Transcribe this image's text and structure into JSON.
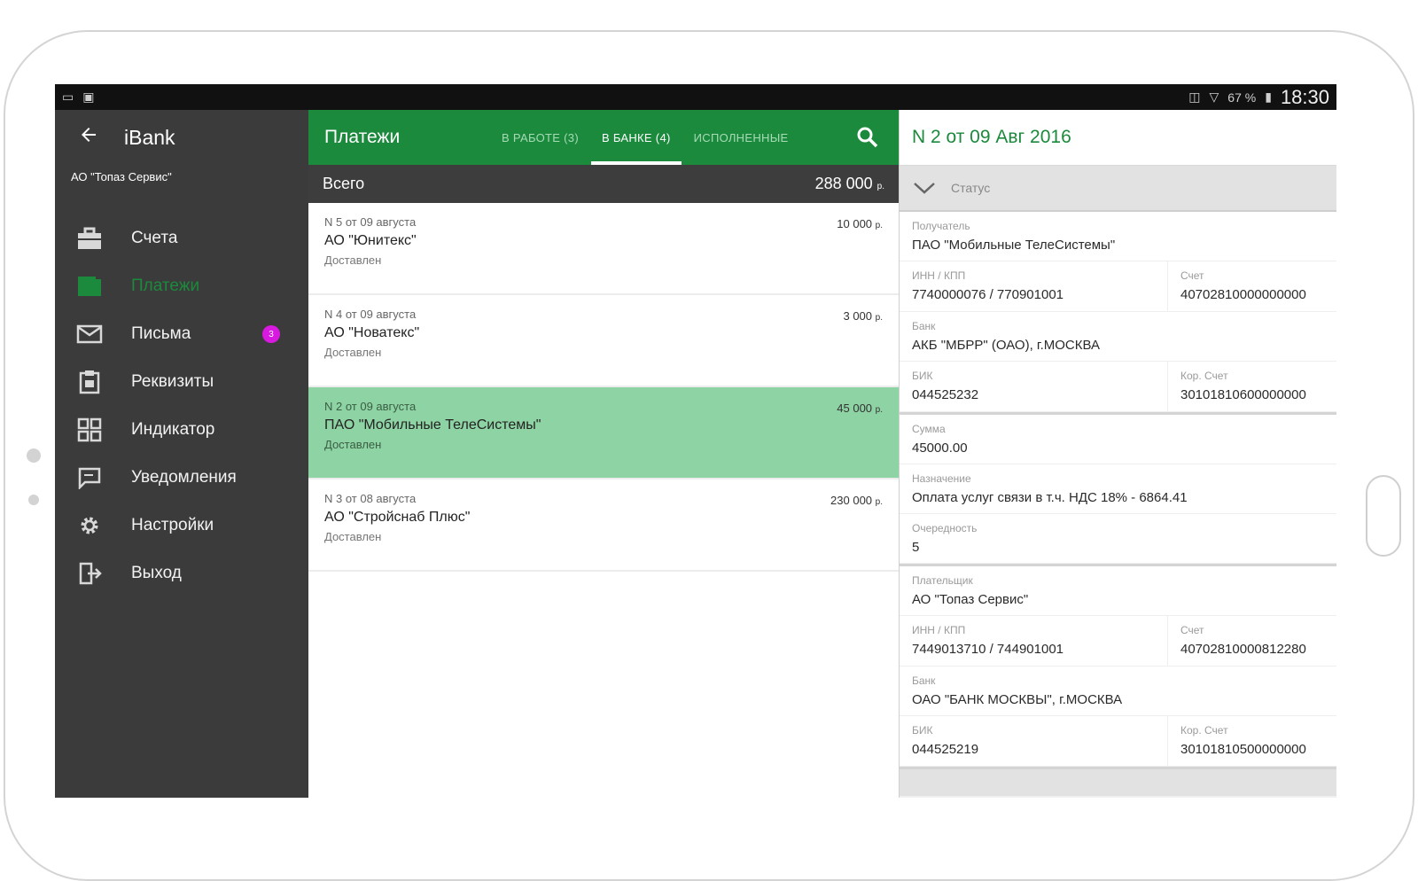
{
  "statusbar": {
    "time": "18:30",
    "battery": "67 %"
  },
  "sidebar": {
    "app_title": "iBank",
    "org": "АО \"Топаз Сервис\"",
    "items": [
      {
        "label": "Счета",
        "icon": "briefcase-icon"
      },
      {
        "label": "Платежи",
        "icon": "wallet-icon",
        "active": true
      },
      {
        "label": "Письма",
        "icon": "envelope-icon",
        "badge": "3"
      },
      {
        "label": "Реквизиты",
        "icon": "clipboard-icon"
      },
      {
        "label": "Индикатор",
        "icon": "dashboard-icon"
      },
      {
        "label": "Уведомления",
        "icon": "message-icon"
      },
      {
        "label": "Настройки",
        "icon": "gear-icon"
      },
      {
        "label": "Выход",
        "icon": "exit-icon"
      }
    ]
  },
  "list": {
    "title": "Платежи",
    "tabs": [
      {
        "label": "В РАБОТЕ (3)"
      },
      {
        "label": "В БАНКЕ (4)",
        "active": true
      },
      {
        "label": "ИСПОЛНЕННЫЕ"
      }
    ],
    "total_label": "Всего",
    "total_value": "288 000",
    "currency": "р.",
    "payments": [
      {
        "line1": "N 5 от 09 августа",
        "name": "АО \"Юнитекс\"",
        "status": "Доставлен",
        "amount": "10 000"
      },
      {
        "line1": "N 4 от 09 августа",
        "name": "АО \"Новатекс\"",
        "status": "Доставлен",
        "amount": "3 000"
      },
      {
        "line1": "N 2 от 09 августа",
        "name": "ПАО \"Мобильные ТелеСистемы\"",
        "status": "Доставлен",
        "amount": "45 000",
        "selected": true
      },
      {
        "line1": "N 3 от 08 августа",
        "name": "АО \"Стройснаб Плюс\"",
        "status": "Доставлен",
        "amount": "230 000"
      }
    ]
  },
  "detail": {
    "title": "N 2 от 09 Авг 2016",
    "status_label": "Статус",
    "recipient": {
      "label": "Получатель",
      "value": "ПАО \"Мобильные ТелеСистемы\"",
      "inn_label": "ИНН / КПП",
      "inn_value": "7740000076 / 770901001",
      "acct_label": "Счет",
      "acct_value": "40702810000000000",
      "bank_label": "Банк",
      "bank_value": "АКБ \"МБРР\" (ОАО), г.МОСКВА",
      "bik_label": "БИК",
      "bik_value": "044525232",
      "kor_label": "Кор. Счет",
      "kor_value": "30101810600000000"
    },
    "payment": {
      "sum_label": "Сумма",
      "sum_value": "45000.00",
      "purpose_label": "Назначение",
      "purpose_value": "Оплата услуг связи в т.ч. НДС 18% - 6864.41",
      "priority_label": "Очередность",
      "priority_value": "5"
    },
    "payer": {
      "label": "Плательщик",
      "value": "АО \"Топаз Сервис\"",
      "inn_label": "ИНН / КПП",
      "inn_value": "7449013710 / 744901001",
      "acct_label": "Счет",
      "acct_value": "40702810000812280",
      "bank_label": "Банк",
      "bank_value": "ОАО \"БАНК МОСКВЫ\", г.МОСКВА",
      "bik_label": "БИК",
      "bik_value": "044525219",
      "kor_label": "Кор. Счет",
      "kor_value": "30101810500000000"
    }
  }
}
